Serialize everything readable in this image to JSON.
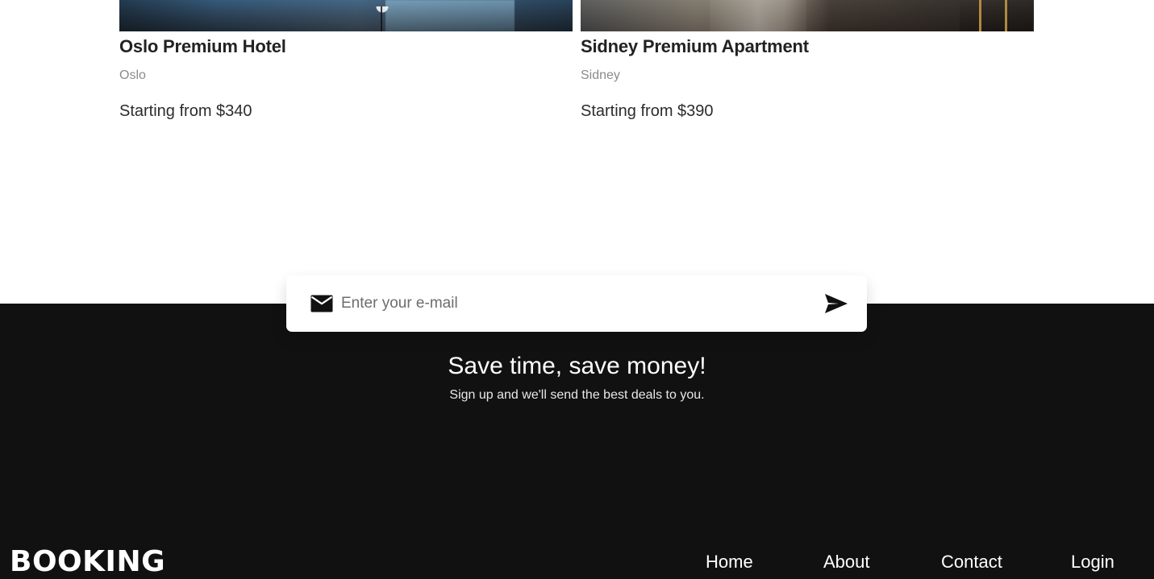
{
  "listings": [
    {
      "title": "Oslo Premium Hotel",
      "location": "Oslo",
      "price_text": "Starting from $340"
    },
    {
      "title": "Sidney Premium Apartment",
      "location": "Sidney",
      "price_text": "Starting from $390"
    }
  ],
  "newsletter": {
    "email_placeholder": "Enter your e-mail",
    "email_value": "",
    "icon_left": "mail-icon",
    "icon_submit": "send-icon",
    "headline": "Save time, save money!",
    "subtext": "Sign up and we'll send the best deals to you."
  },
  "footer": {
    "brand": "BOOKING",
    "nav": [
      {
        "label": "Home"
      },
      {
        "label": "About"
      },
      {
        "label": "Contact"
      },
      {
        "label": "Login"
      }
    ]
  },
  "colors": {
    "footer_bg": "#111111",
    "card_title": "#222222",
    "card_location": "#8b8b8b",
    "price_text": "#2c2c2c",
    "white": "#ffffff"
  }
}
